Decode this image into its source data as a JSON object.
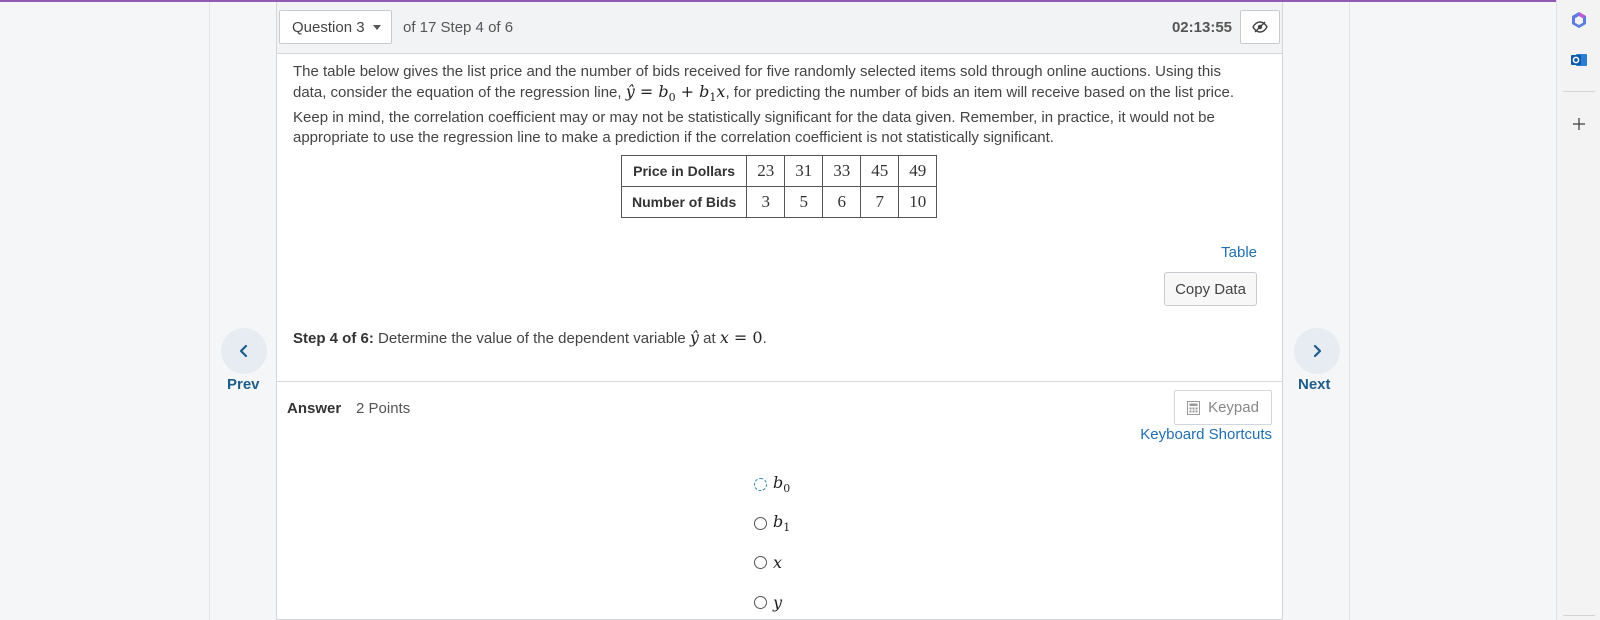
{
  "header": {
    "question_select": "Question 3",
    "progress": "of 17 Step 4 of 6",
    "timer": "02:13:55"
  },
  "question": {
    "text_before_eq": "The table below gives the list price and the number of bids received for five randomly selected items sold through online auctions. Using this data, consider the equation of the regression line, ",
    "text_after_eq": ", for predicting the number of bids an item will receive based on the list price. Keep in mind, the correlation coefficient may or may not be statistically significant for the data given. Remember, in practice, it would not be appropriate to use the regression line to make a prediction if the correlation coefficient is not statistically significant."
  },
  "table": {
    "rows": [
      {
        "header": "Price in Dollars",
        "values": [
          "23",
          "31",
          "33",
          "45",
          "49"
        ]
      },
      {
        "header": "Number of Bids",
        "values": [
          "3",
          "5",
          "6",
          "7",
          "10"
        ]
      }
    ]
  },
  "links": {
    "table": "Table",
    "copy_data": "Copy Data",
    "keyboard_shortcuts": "Keyboard Shortcuts"
  },
  "step": {
    "label": "Step 4 of 6:",
    "text": " Determine the value of the dependent variable ",
    "text_at": " at "
  },
  "answer": {
    "label": "Answer",
    "points": "2 Points",
    "keypad": "Keypad"
  },
  "options": [
    {
      "var": "b",
      "sub": "0"
    },
    {
      "var": "b",
      "sub": "1"
    },
    {
      "var": "x",
      "sub": ""
    },
    {
      "var": "y",
      "sub": ""
    }
  ],
  "nav": {
    "prev": "Prev",
    "next": "Next"
  },
  "colors": {
    "accent": "#8e5bb5",
    "link": "#1f6fb2",
    "nav_text": "#1f5d8c"
  }
}
